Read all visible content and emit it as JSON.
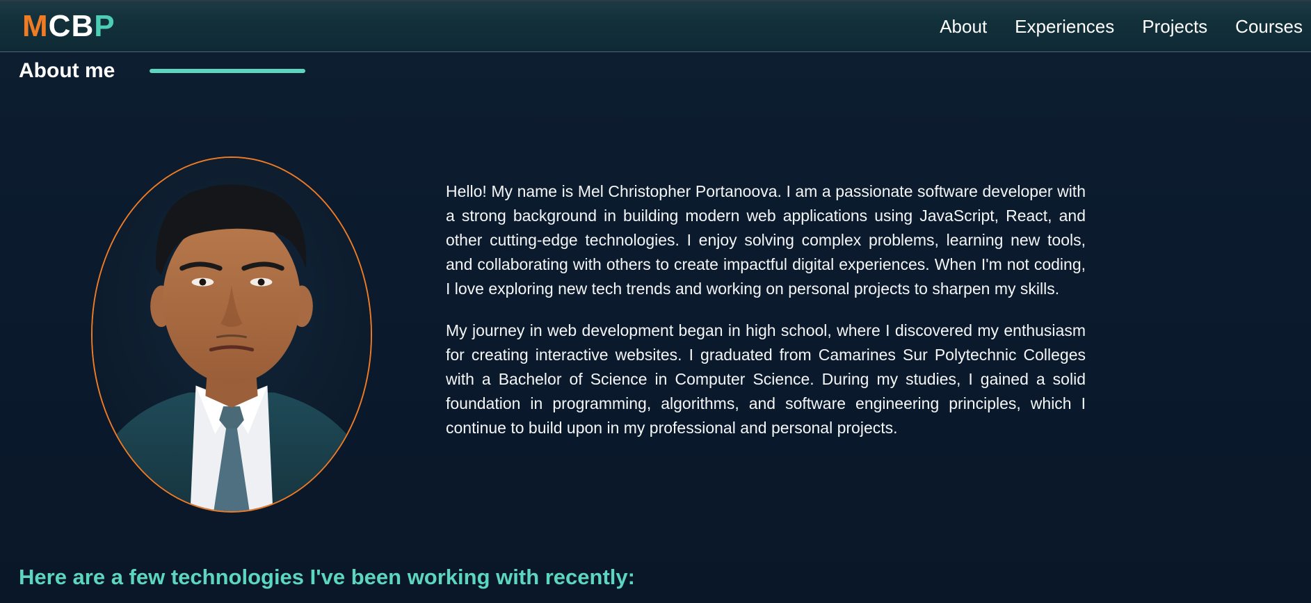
{
  "navbar": {
    "logo": {
      "letters": [
        "M",
        "C",
        "B",
        "P"
      ]
    },
    "links": [
      {
        "label": "About"
      },
      {
        "label": "Experiences"
      },
      {
        "label": "Projects"
      },
      {
        "label": "Courses"
      }
    ]
  },
  "about": {
    "title": "About me",
    "paragraphs": [
      "Hello! My name is Mel Christopher Portanoova. I am a passionate software developer with a strong background in building modern web applications using JavaScript, React, and other cutting-edge technologies. I enjoy solving complex problems, learning new tools, and collaborating with others to create impactful digital experiences. When I'm not coding, I love exploring new tech trends and working on personal projects to sharpen my skills.",
      "My journey in web development began in high school, where I discovered my enthusiasm for creating interactive websites. I graduated from Camarines Sur Polytechnic Colleges with a Bachelor of Science in Computer Science. During my studies, I gained a solid foundation in programming, algorithms, and software engineering principles, which I continue to build upon in my professional and personal projects."
    ],
    "technologies_heading": "Here are a few technologies I've been working with recently:"
  },
  "colors": {
    "accent": "#5cd6bf",
    "logo_orange": "#f07b25",
    "logo_white": "#ffffff",
    "logo_teal": "#4ecdb5",
    "portrait_border": "#f07b25",
    "background": "#0b1a2c"
  },
  "icons": {
    "portrait": "profile-photo"
  }
}
